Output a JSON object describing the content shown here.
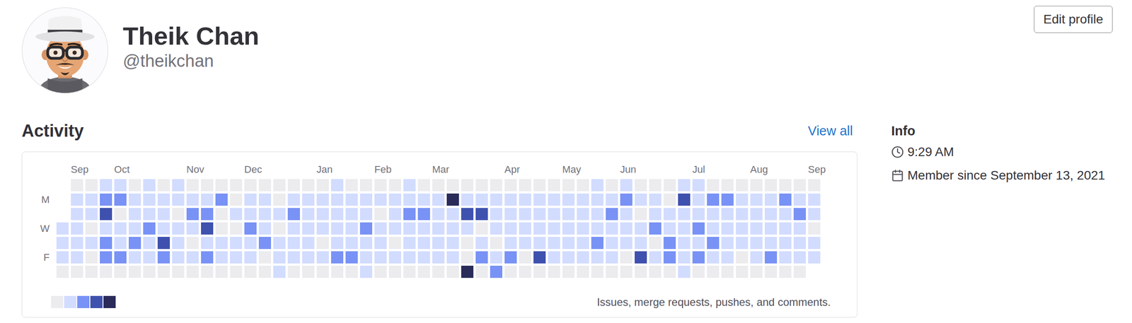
{
  "user": {
    "name": "Theik Chan",
    "handle": "@theikchan"
  },
  "edit_button": "Edit profile",
  "activity": {
    "title": "Activity",
    "link": "View all",
    "months": [
      {
        "label": "Sep",
        "week": 1
      },
      {
        "label": "Oct",
        "week": 4
      },
      {
        "label": "Nov",
        "week": 9
      },
      {
        "label": "Dec",
        "week": 13
      },
      {
        "label": "Jan",
        "week": 18
      },
      {
        "label": "Feb",
        "week": 22
      },
      {
        "label": "Mar",
        "week": 26
      },
      {
        "label": "Apr",
        "week": 31
      },
      {
        "label": "May",
        "week": 35
      },
      {
        "label": "Jun",
        "week": 39
      },
      {
        "label": "Jul",
        "week": 44
      },
      {
        "label": "Aug",
        "week": 48
      },
      {
        "label": "Sep",
        "week": 52
      }
    ],
    "day_labels": [
      "",
      "M",
      "",
      "W",
      "",
      "F",
      ""
    ],
    "weeks": [
      [
        null,
        null,
        null,
        1,
        1,
        1,
        0
      ],
      [
        0,
        1,
        1,
        1,
        1,
        1,
        0
      ],
      [
        0,
        1,
        1,
        0,
        1,
        0,
        0
      ],
      [
        1,
        2,
        3,
        1,
        2,
        2,
        0
      ],
      [
        1,
        2,
        0,
        1,
        1,
        2,
        0
      ],
      [
        0,
        1,
        1,
        1,
        2,
        1,
        0
      ],
      [
        1,
        1,
        1,
        2,
        1,
        1,
        0
      ],
      [
        0,
        1,
        1,
        1,
        3,
        2,
        0
      ],
      [
        1,
        1,
        0,
        1,
        1,
        1,
        0
      ],
      [
        0,
        1,
        2,
        1,
        0,
        1,
        0
      ],
      [
        0,
        1,
        2,
        3,
        1,
        2,
        0
      ],
      [
        0,
        2,
        0,
        0,
        1,
        1,
        0
      ],
      [
        0,
        0,
        1,
        0,
        1,
        1,
        0
      ],
      [
        0,
        1,
        1,
        2,
        1,
        1,
        0
      ],
      [
        0,
        1,
        1,
        1,
        2,
        0,
        0
      ],
      [
        0,
        0,
        1,
        0,
        1,
        1,
        1
      ],
      [
        0,
        1,
        2,
        1,
        1,
        1,
        0
      ],
      [
        0,
        1,
        1,
        1,
        1,
        1,
        0
      ],
      [
        0,
        1,
        1,
        1,
        0,
        1,
        0
      ],
      [
        1,
        1,
        1,
        1,
        1,
        2,
        0
      ],
      [
        0,
        1,
        1,
        1,
        1,
        2,
        0
      ],
      [
        0,
        1,
        1,
        2,
        1,
        1,
        1
      ],
      [
        0,
        1,
        0,
        1,
        1,
        1,
        0
      ],
      [
        0,
        1,
        1,
        1,
        0,
        1,
        0
      ],
      [
        1,
        1,
        2,
        1,
        1,
        1,
        0
      ],
      [
        0,
        1,
        2,
        1,
        1,
        1,
        0
      ],
      [
        0,
        1,
        1,
        1,
        1,
        1,
        0
      ],
      [
        0,
        4,
        1,
        1,
        1,
        1,
        0
      ],
      [
        0,
        1,
        3,
        1,
        0,
        0,
        4
      ],
      [
        0,
        1,
        3,
        0,
        1,
        2,
        0
      ],
      [
        0,
        1,
        1,
        1,
        0,
        1,
        2
      ],
      [
        0,
        1,
        1,
        1,
        1,
        2,
        0
      ],
      [
        0,
        1,
        1,
        1,
        1,
        0,
        0
      ],
      [
        0,
        1,
        1,
        1,
        1,
        3,
        0
      ],
      [
        0,
        1,
        1,
        1,
        1,
        1,
        0
      ],
      [
        0,
        1,
        1,
        1,
        1,
        1,
        0
      ],
      [
        0,
        1,
        1,
        1,
        1,
        1,
        0
      ],
      [
        1,
        1,
        1,
        1,
        2,
        1,
        0
      ],
      [
        0,
        1,
        2,
        1,
        1,
        1,
        0
      ],
      [
        1,
        2,
        1,
        1,
        1,
        0,
        0
      ],
      [
        0,
        1,
        0,
        1,
        1,
        3,
        0
      ],
      [
        0,
        1,
        1,
        2,
        0,
        1,
        0
      ],
      [
        0,
        0,
        1,
        1,
        2,
        2,
        0
      ],
      [
        1,
        3,
        1,
        1,
        1,
        1,
        1
      ],
      [
        1,
        1,
        1,
        2,
        1,
        2,
        0
      ],
      [
        0,
        2,
        1,
        1,
        2,
        1,
        0
      ],
      [
        0,
        2,
        1,
        1,
        1,
        1,
        0
      ],
      [
        0,
        1,
        1,
        1,
        1,
        0,
        0
      ],
      [
        0,
        1,
        1,
        1,
        1,
        1,
        0
      ],
      [
        0,
        1,
        1,
        1,
        1,
        2,
        0
      ],
      [
        0,
        2,
        1,
        1,
        1,
        1,
        0
      ],
      [
        0,
        1,
        2,
        1,
        1,
        1,
        0
      ],
      [
        0,
        1,
        1,
        0,
        1,
        1,
        null
      ]
    ],
    "legend_levels": [
      0,
      1,
      2,
      3,
      4
    ],
    "caption": "Issues, merge requests, pushes, and comments."
  },
  "info": {
    "title": "Info",
    "items": [
      {
        "kind": "time",
        "text": "9:29 AM"
      },
      {
        "kind": "member",
        "text": "Member since September 13, 2021"
      }
    ]
  }
}
